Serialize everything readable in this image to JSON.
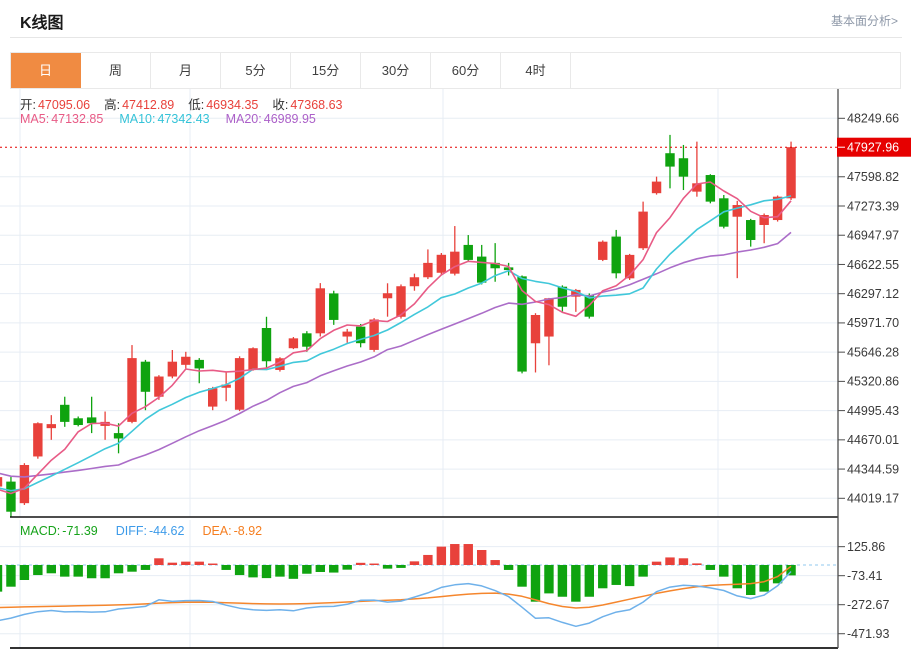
{
  "header": {
    "title": "K线图",
    "link_label": "基本面分析>"
  },
  "tabs": {
    "items": [
      {
        "label": "日",
        "active": true
      },
      {
        "label": "周",
        "active": false
      },
      {
        "label": "月",
        "active": false
      },
      {
        "label": "5分",
        "active": false
      },
      {
        "label": "15分",
        "active": false
      },
      {
        "label": "30分",
        "active": false
      },
      {
        "label": "60分",
        "active": false
      },
      {
        "label": "4时",
        "active": false
      }
    ]
  },
  "legend": {
    "ohlc": [
      {
        "label": "开:",
        "value": "47095.06"
      },
      {
        "label": "高:",
        "value": "47412.89"
      },
      {
        "label": "低:",
        "value": "46934.35"
      },
      {
        "label": "收:",
        "value": "47368.63"
      }
    ],
    "ma": [
      {
        "label": "MA5:",
        "value": "47132.85",
        "color": "#e85b86"
      },
      {
        "label": "MA10:",
        "value": "47342.43",
        "color": "#35c3d8"
      },
      {
        "label": "MA20:",
        "value": "46989.95",
        "color": "#ab5fc8"
      }
    ],
    "macd": [
      {
        "label": "MACD:",
        "value": "-71.39",
        "color": "#16a31a"
      },
      {
        "label": "DIFF:",
        "value": "-44.62",
        "color": "#3d9be9"
      },
      {
        "label": "DEA:",
        "value": "-8.92",
        "color": "#f57e20"
      }
    ]
  },
  "chart_data": {
    "type": "candlestick+macd",
    "colors": {
      "up": "#e8413b",
      "down": "#0fa30f",
      "ma5": "#e85b86",
      "ma10": "#41c8da",
      "ma20": "#ab6dc8",
      "diff_line": "#6fb1ea",
      "dea_line": "#f5862d",
      "grid": "#e7edf4",
      "axis": "#4d4d4d",
      "divider": "#141414",
      "tick_text": "#3a3a3a",
      "badge": "#e60000",
      "zero_dash": "#a6d3f2"
    },
    "main": {
      "y_ticks": [
        "48249.66",
        "47598.82",
        "47273.39",
        "46947.97",
        "46622.55",
        "46297.12",
        "45971.70",
        "45646.28",
        "45320.86",
        "44995.43",
        "44670.01",
        "44344.59",
        "44019.17"
      ],
      "last_price": "47927.96",
      "price_range": {
        "top": 48587,
        "bottom": 43811
      },
      "ma_windows": [
        5,
        10,
        20
      ],
      "prehistory_closes": [
        44600,
        44560,
        44520,
        44500,
        44480,
        44460,
        44430,
        44400,
        44380,
        44350,
        44200,
        44170,
        44150,
        44130,
        44120,
        44100,
        44090,
        44080,
        44070
      ],
      "candles": [
        [
          44150,
          44260,
          44050,
          44255
        ],
        [
          44205,
          44260,
          43815,
          43870
        ],
        [
          43965,
          44410,
          43945,
          44390
        ],
        [
          44485,
          44865,
          44460,
          44855
        ],
        [
          44800,
          44945,
          44670,
          44845
        ],
        [
          45060,
          45150,
          44815,
          44870
        ],
        [
          44910,
          44930,
          44820,
          44835
        ],
        [
          44920,
          45150,
          44745,
          44855
        ],
        [
          44825,
          44985,
          44670,
          44870
        ],
        [
          44745,
          44855,
          44520,
          44685
        ],
        [
          44870,
          45725,
          44855,
          45580
        ],
        [
          45540,
          45560,
          45000,
          45205
        ],
        [
          45150,
          45390,
          45115,
          45375
        ],
        [
          45375,
          45670,
          45355,
          45540
        ],
        [
          45505,
          45650,
          45465,
          45595
        ],
        [
          45560,
          45580,
          45300,
          45465
        ],
        [
          45040,
          45260,
          45000,
          45245
        ],
        [
          45250,
          45430,
          45100,
          45285
        ],
        [
          45005,
          45600,
          44990,
          45580
        ],
        [
          45450,
          45700,
          45440,
          45690
        ],
        [
          45915,
          46040,
          45465,
          45545
        ],
        [
          45448,
          45590,
          45430,
          45578
        ],
        [
          45690,
          45815,
          45680,
          45800
        ],
        [
          45856,
          45880,
          45650,
          45707
        ],
        [
          45856,
          46415,
          45820,
          46357
        ],
        [
          46300,
          46330,
          45950,
          46005
        ],
        [
          45820,
          45905,
          45750,
          45875
        ],
        [
          45930,
          45960,
          45700,
          45746
        ],
        [
          45671,
          46025,
          45650,
          46010
        ],
        [
          46246,
          46413,
          46041,
          46302
        ],
        [
          46040,
          46400,
          46020,
          46380
        ],
        [
          46380,
          46520,
          46330,
          46480
        ],
        [
          46480,
          46790,
          46460,
          46640
        ],
        [
          46530,
          46750,
          46510,
          46730
        ],
        [
          46520,
          47050,
          46500,
          46765
        ],
        [
          46840,
          46950,
          46650,
          46673
        ],
        [
          46710,
          46840,
          46400,
          46420
        ],
        [
          46640,
          46860,
          46430,
          46580
        ],
        [
          46590,
          46640,
          46500,
          46560
        ],
        [
          46490,
          46500,
          45410,
          45430
        ],
        [
          45745,
          46080,
          45420,
          46060
        ],
        [
          45820,
          46250,
          45500,
          46246
        ],
        [
          46375,
          46390,
          46100,
          46152
        ],
        [
          46264,
          46350,
          46095,
          46339
        ],
        [
          46283,
          46300,
          46020,
          46041
        ],
        [
          46673,
          46890,
          46660,
          46876
        ],
        [
          46933,
          47007,
          46468,
          46524
        ],
        [
          46468,
          46740,
          46450,
          46729
        ],
        [
          46803,
          47322,
          46784,
          47211
        ],
        [
          47416,
          47600,
          47400,
          47545
        ],
        [
          47861,
          48065,
          47470,
          47712
        ],
        [
          47805,
          47953,
          47451,
          47600
        ],
        [
          47433,
          47990,
          47377,
          47526
        ],
        [
          47618,
          47627,
          47303,
          47322
        ],
        [
          47359,
          47396,
          47024,
          47043
        ],
        [
          47154,
          47330,
          46470,
          47284
        ],
        [
          47117,
          47130,
          46821,
          46895
        ],
        [
          47062,
          47190,
          46859,
          47173
        ],
        [
          47117,
          47390,
          47100,
          47377
        ],
        [
          47359,
          47990,
          47340,
          47928
        ]
      ]
    },
    "macd": {
      "y_ticks": [
        "125.86",
        "-73.41",
        "-272.67",
        "-471.93"
      ],
      "value_range": {
        "top": 309,
        "bottom": -570
      },
      "histogram": [
        -183,
        -149,
        -103,
        -69,
        -57,
        -80,
        -80,
        -91,
        -91,
        -57,
        -46,
        -34,
        46,
        16,
        23,
        23,
        10,
        -34,
        -69,
        -85,
        -90,
        -80,
        -95,
        -60,
        -48,
        -52,
        -32,
        15,
        10,
        -25,
        -20,
        25,
        69,
        126,
        144,
        144,
        103,
        34,
        -34,
        -149,
        -252,
        -195,
        -218,
        -252,
        -218,
        -160,
        -137,
        -145,
        -80,
        23,
        52,
        46,
        11,
        -34,
        -80,
        -160,
        -206,
        -183,
        -126,
        -71.39
      ],
      "diff": [
        -383.5,
        -364.5,
        -339.5,
        -320.5,
        -312.5,
        -322,
        -320,
        -323.5,
        -321.5,
        -302.5,
        -294,
        -284,
        -239,
        -250,
        -244.5,
        -243.5,
        -251,
        -276,
        -296.5,
        -307.5,
        -312,
        -308,
        -314.5,
        -295,
        -286,
        -284,
        -270,
        -242.5,
        -241,
        -254.5,
        -248,
        -220.5,
        -191.5,
        -154,
        -136,
        -128,
        -143.5,
        -176,
        -217,
        -290,
        -366,
        -362.5,
        -394,
        -421,
        -399,
        -355,
        -323.5,
        -307.5,
        -255,
        -183.5,
        -152,
        -139,
        -144.5,
        -157,
        -175,
        -212,
        -231,
        -206.5,
        -143,
        -44.62
      ],
      "dea": [
        -292,
        -290,
        -288,
        -286,
        -284,
        -282,
        -280,
        -278,
        -276,
        -274,
        -271,
        -267,
        -262,
        -258,
        -256,
        -255,
        -256,
        -259,
        -262,
        -265,
        -267,
        -268,
        -267,
        -265,
        -262,
        -258,
        -254,
        -250,
        -246,
        -242,
        -238,
        -233,
        -226,
        -217,
        -208,
        -200,
        -195,
        -193,
        -200,
        -215,
        -240,
        -265,
        -285,
        -295,
        -290,
        -275,
        -255,
        -235,
        -215,
        -195,
        -178,
        -162,
        -150,
        -140,
        -135,
        -132,
        -128,
        -115,
        -80,
        -8.92
      ]
    }
  }
}
